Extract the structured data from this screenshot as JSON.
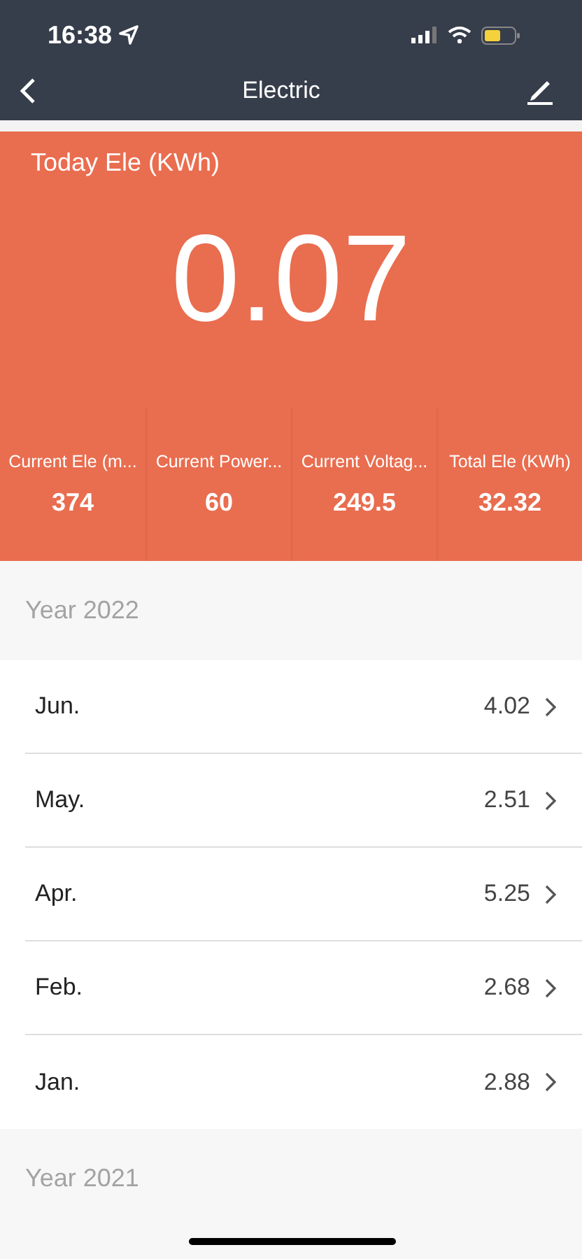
{
  "status_bar": {
    "time": "16:38"
  },
  "nav": {
    "title": "Electric"
  },
  "today": {
    "label": "Today Ele (KWh)",
    "value": "0.07"
  },
  "stats": [
    {
      "label": "Current Ele (m...",
      "value": "374"
    },
    {
      "label": "Current Power...",
      "value": "60"
    },
    {
      "label": "Current Voltag...",
      "value": "249.5"
    },
    {
      "label": "Total Ele (KWh)",
      "value": "32.32"
    }
  ],
  "years": [
    {
      "title": "Year 2022",
      "months": [
        {
          "name": "Jun.",
          "value": "4.02"
        },
        {
          "name": "May.",
          "value": "2.51"
        },
        {
          "name": "Apr.",
          "value": "5.25"
        },
        {
          "name": "Feb.",
          "value": "2.68"
        },
        {
          "name": "Jan.",
          "value": "2.88"
        }
      ]
    },
    {
      "title": "Year 2021"
    }
  ]
}
